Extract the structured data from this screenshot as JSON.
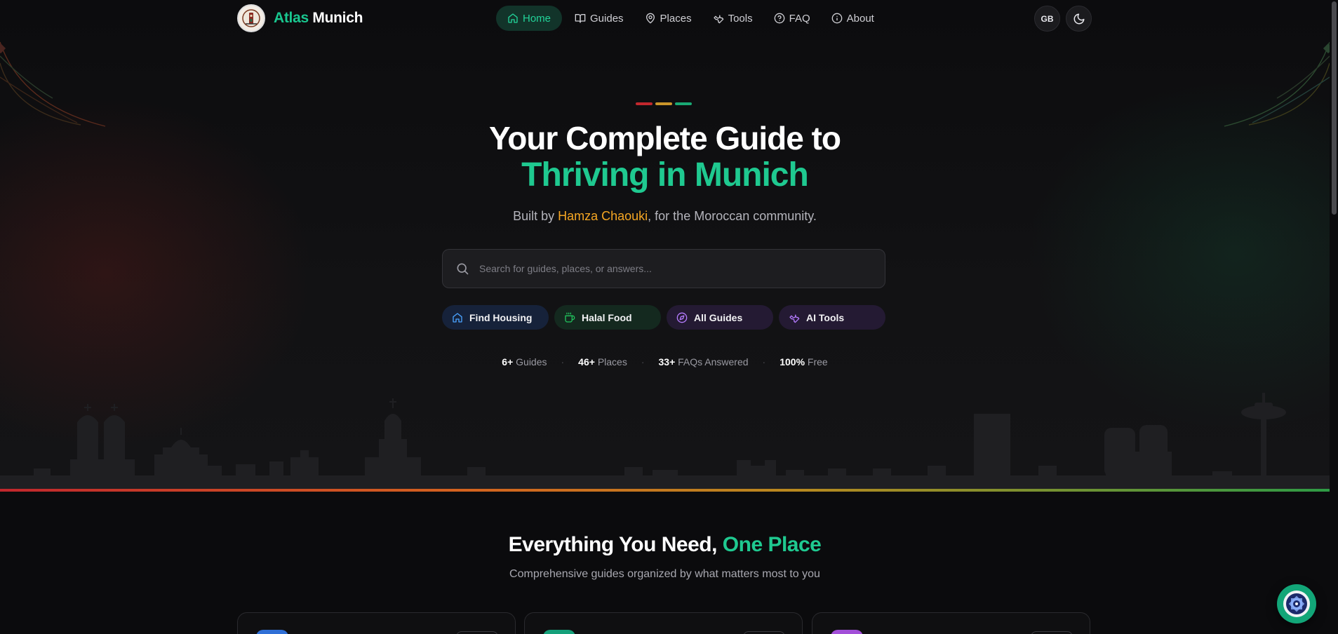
{
  "brand": {
    "name_part1": "Atlas",
    "name_part2": "Munich"
  },
  "nav": {
    "items": [
      {
        "label": "Home",
        "icon": "home-icon",
        "active": true
      },
      {
        "label": "Guides",
        "icon": "book-icon"
      },
      {
        "label": "Places",
        "icon": "map-pin-icon"
      },
      {
        "label": "Tools",
        "icon": "wrench-icon"
      },
      {
        "label": "FAQ",
        "icon": "help-circle-icon"
      },
      {
        "label": "About",
        "icon": "info-icon"
      }
    ],
    "language_label": "GB",
    "theme_icon": "moon-icon"
  },
  "hero": {
    "title_line1": "Your Complete Guide to",
    "title_line2": "Thriving in Munich",
    "subtitle_prefix": "Built by ",
    "subtitle_name": "Hamza Chaouki",
    "subtitle_suffix": ", for the Moroccan community.",
    "search_placeholder": "Search for guides, places, or answers...",
    "chips": [
      {
        "label": "Find Housing",
        "icon": "home-icon",
        "color": "#4aa3ff"
      },
      {
        "label": "Halal Food",
        "icon": "coffee-icon",
        "color": "#22c55e"
      },
      {
        "label": "All Guides",
        "icon": "compass-icon",
        "color": "#b57cff"
      },
      {
        "label": "AI Tools",
        "icon": "wrench-icon",
        "color": "#b57cff"
      }
    ],
    "stats": [
      {
        "value": "6+",
        "label": "Guides"
      },
      {
        "value": "46+",
        "label": "Places"
      },
      {
        "value": "33+",
        "label": "FAQs Answered"
      },
      {
        "value": "100%",
        "label": "Free"
      }
    ],
    "accent_colors": [
      "#c1272d",
      "#c9952a",
      "#19a974"
    ]
  },
  "section": {
    "title_prefix": "Everything You Need, ",
    "title_highlight": "One Place",
    "subtitle": "Comprehensive guides organized by what matters most to you"
  },
  "colors": {
    "brand_green": "#1fc990",
    "accent_orange": "#f5a623",
    "background": "#0b0b0d"
  }
}
